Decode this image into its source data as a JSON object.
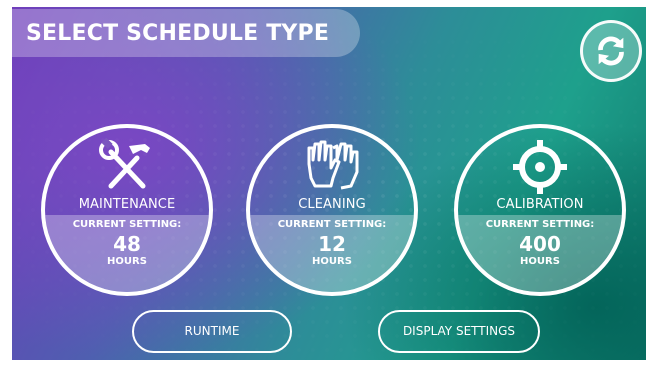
{
  "header": {
    "title": "SELECT SCHEDULE TYPE"
  },
  "cards": [
    {
      "label": "MAINTENANCE",
      "setting_label": "CURRENT SETTING:",
      "value": "48",
      "unit": "HOURS",
      "icon": "tools-icon"
    },
    {
      "label": "CLEANING",
      "setting_label": "CURRENT SETTING:",
      "value": "12",
      "unit": "HOURS",
      "icon": "gloves-icon"
    },
    {
      "label": "CALIBRATION",
      "setting_label": "CURRENT SETTING:",
      "value": "400",
      "unit": "HOURS",
      "icon": "crosshair-icon"
    }
  ],
  "footer": {
    "runtime_label": "RUNTIME",
    "display_settings_label": "DISPLAY SETTINGS"
  },
  "icons": {
    "refresh": "refresh-icon"
  },
  "colors": {
    "purple": "#6c3cb9",
    "teal": "#1ea08c",
    "dark_teal": "#0f7a6c",
    "white": "#ffffff"
  }
}
